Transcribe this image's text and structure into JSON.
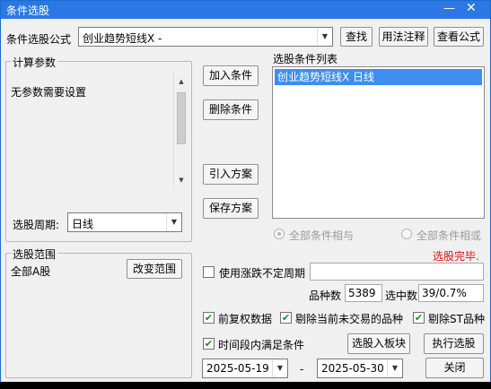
{
  "window": {
    "title": "条件选股",
    "minimize_glyph": "—",
    "close_glyph": "✕"
  },
  "formula": {
    "label": "条件选股公式",
    "selected": "创业趋势短线X -",
    "find_button": "查找",
    "usage_button": "用法注释",
    "view_button": "查看公式"
  },
  "params": {
    "group_label": "计算参数",
    "text": "无参数需要设置",
    "period_label": "选股周期:",
    "period_value": "日线"
  },
  "actions": {
    "add_condition": "加入条件",
    "delete_condition": "删除条件",
    "import_plan": "引入方案",
    "save_plan": "保存方案"
  },
  "condition_list": {
    "label": "选股条件列表",
    "items": [
      "创业趋势短线X  日线"
    ]
  },
  "logic": {
    "all_and": "全部条件相与",
    "all_or": "全部条件相或"
  },
  "status": {
    "text": "选股完毕.",
    "color": "#e01010"
  },
  "scope": {
    "group_label": "选股范围",
    "value": "全部A股",
    "change_button": "改变范围"
  },
  "options": {
    "use_indefinite_period": "使用涨跌不定周期",
    "use_indefinite_period_checked": false,
    "count_label": "品种数",
    "count_value": "5389",
    "selected_label": "选中数",
    "selected_value": "39/0.7%",
    "forward_adjust": "前复权数据",
    "forward_adjust_checked": true,
    "exclude_untraded": "剔除当前未交易的品种",
    "exclude_untraded_checked": true,
    "exclude_st": "剔除ST品种",
    "exclude_st_checked": true,
    "period_satisfy": "时间段内满足条件",
    "period_satisfy_checked": true,
    "start_date": "2025-05-19",
    "date_separator": "-",
    "end_date": "2025-05-30",
    "to_block_button": "选股入板块",
    "run_button": "执行选股",
    "close_button": "关闭",
    "check_glyph": "✔"
  }
}
